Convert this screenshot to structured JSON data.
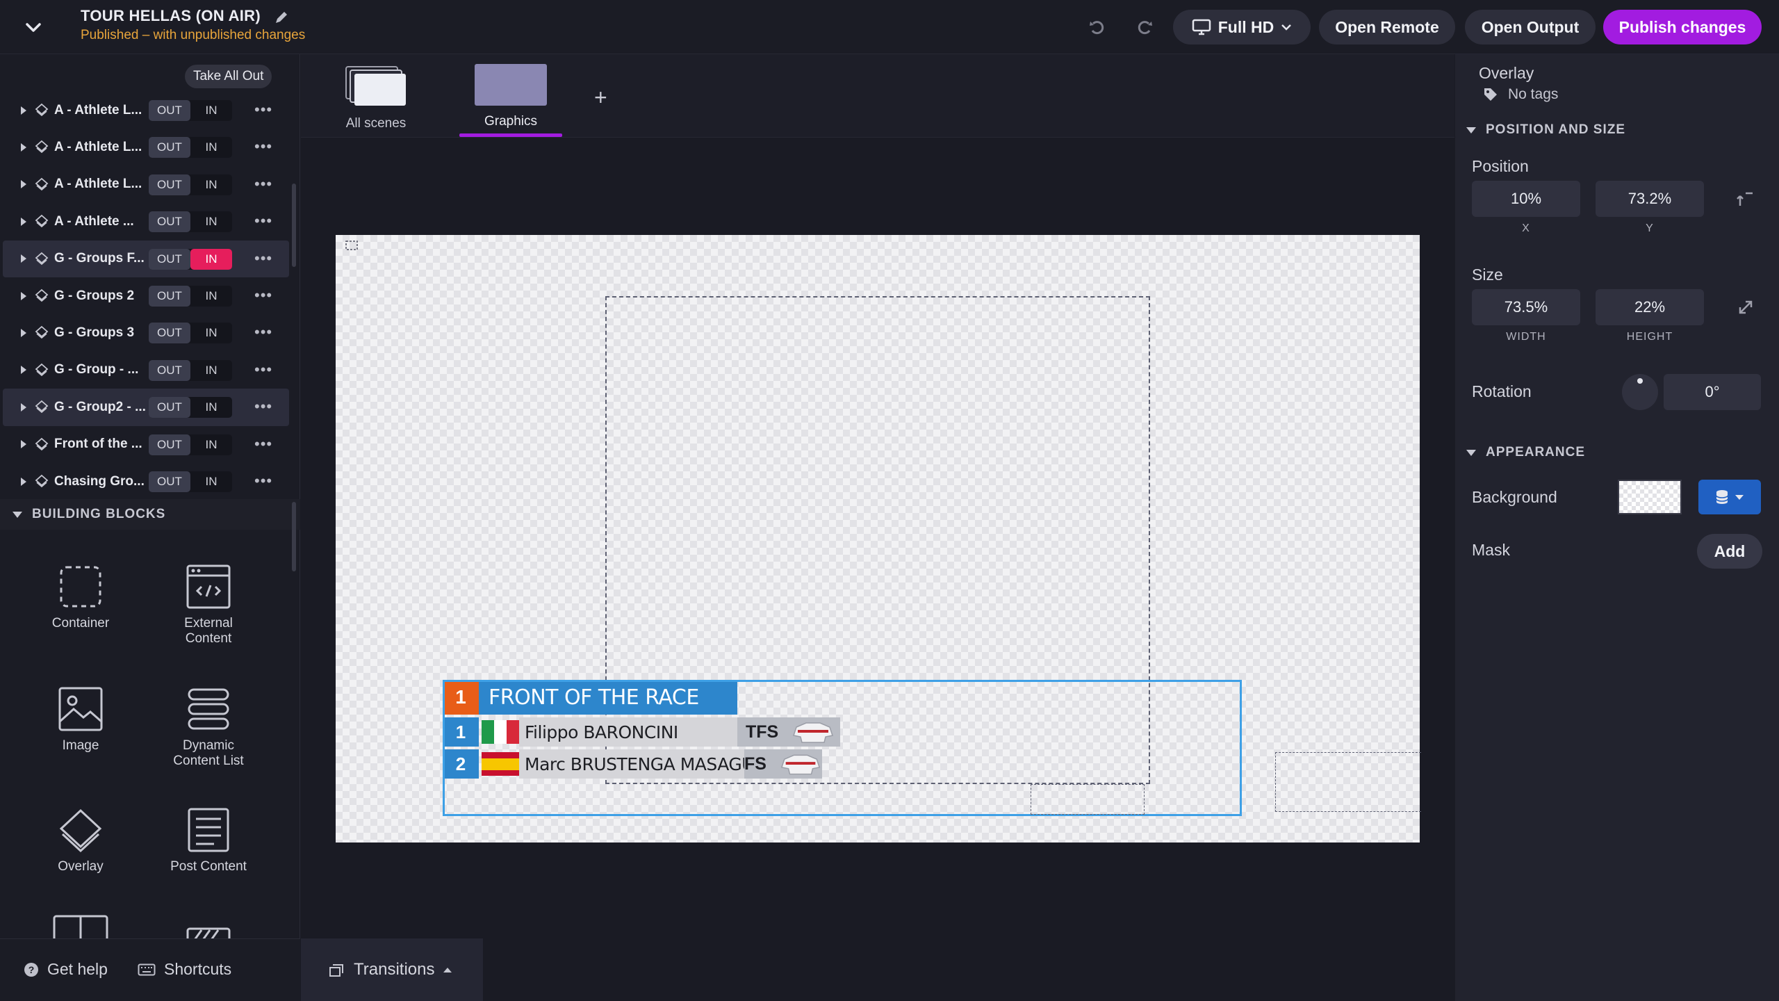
{
  "header": {
    "title": "TOUR HELLAS (ON AIR)",
    "status": "Published – with unpublished changes",
    "resolution": "Full HD",
    "open_remote": "Open Remote",
    "open_output": "Open Output",
    "publish": "Publish changes",
    "colors": {
      "accent": "#a21ce0",
      "status": "#e8a53b"
    }
  },
  "layers": {
    "take_all_out": "Take All Out",
    "out_label": "OUT",
    "in_label": "IN",
    "items": [
      {
        "name": "A - Athlete L...",
        "active_in": false
      },
      {
        "name": "A - Athlete L...",
        "active_in": false
      },
      {
        "name": "A - Athlete L...",
        "active_in": false
      },
      {
        "name": "A - Athlete ...",
        "active_in": false
      },
      {
        "name": "G - Groups F...",
        "active_in": true
      },
      {
        "name": "G - Groups 2",
        "active_in": false
      },
      {
        "name": "G - Groups 3",
        "active_in": false
      },
      {
        "name": "G - Group - ...",
        "active_in": false
      },
      {
        "name": "G - Group2 - ...",
        "active_in": false
      },
      {
        "name": "Front of the ...",
        "active_in": false
      },
      {
        "name": "Chasing Gro...",
        "active_in": false
      }
    ]
  },
  "building_blocks": {
    "heading": "BUILDING BLOCKS",
    "container": "Container",
    "external_content_1": "External",
    "external_content_2": "Content",
    "image": "Image",
    "dynamic_list_1": "Dynamic",
    "dynamic_list_2": "Content List",
    "overlay": "Overlay",
    "post_content": "Post Content"
  },
  "footer": {
    "help": "Get help",
    "shortcuts": "Shortcuts",
    "transitions": "Transitions"
  },
  "scenes": {
    "all": "All scenes",
    "graphics": "Graphics",
    "add": "+"
  },
  "graphic": {
    "header_number": "1",
    "header_text": "FRONT OF THE RACE",
    "riders": [
      {
        "pos": "1",
        "name": "Filippo BARONCINI",
        "team": "TFS"
      },
      {
        "pos": "2",
        "name": "Marc BRUSTENGA MASAGUE",
        "team": "FS"
      }
    ]
  },
  "inspector": {
    "title": "Overlay",
    "tags": "No tags",
    "position_size": "POSITION AND SIZE",
    "position": "Position",
    "x_value": "10%",
    "y_value": "73.2%",
    "x_label": "X",
    "y_label": "Y",
    "size": "Size",
    "width_value": "73.5%",
    "height_value": "22%",
    "width_label": "WIDTH",
    "height_label": "HEIGHT",
    "rotation": "Rotation",
    "rotation_value": "0°",
    "appearance": "APPEARANCE",
    "background": "Background",
    "mask": "Mask",
    "add": "Add"
  }
}
